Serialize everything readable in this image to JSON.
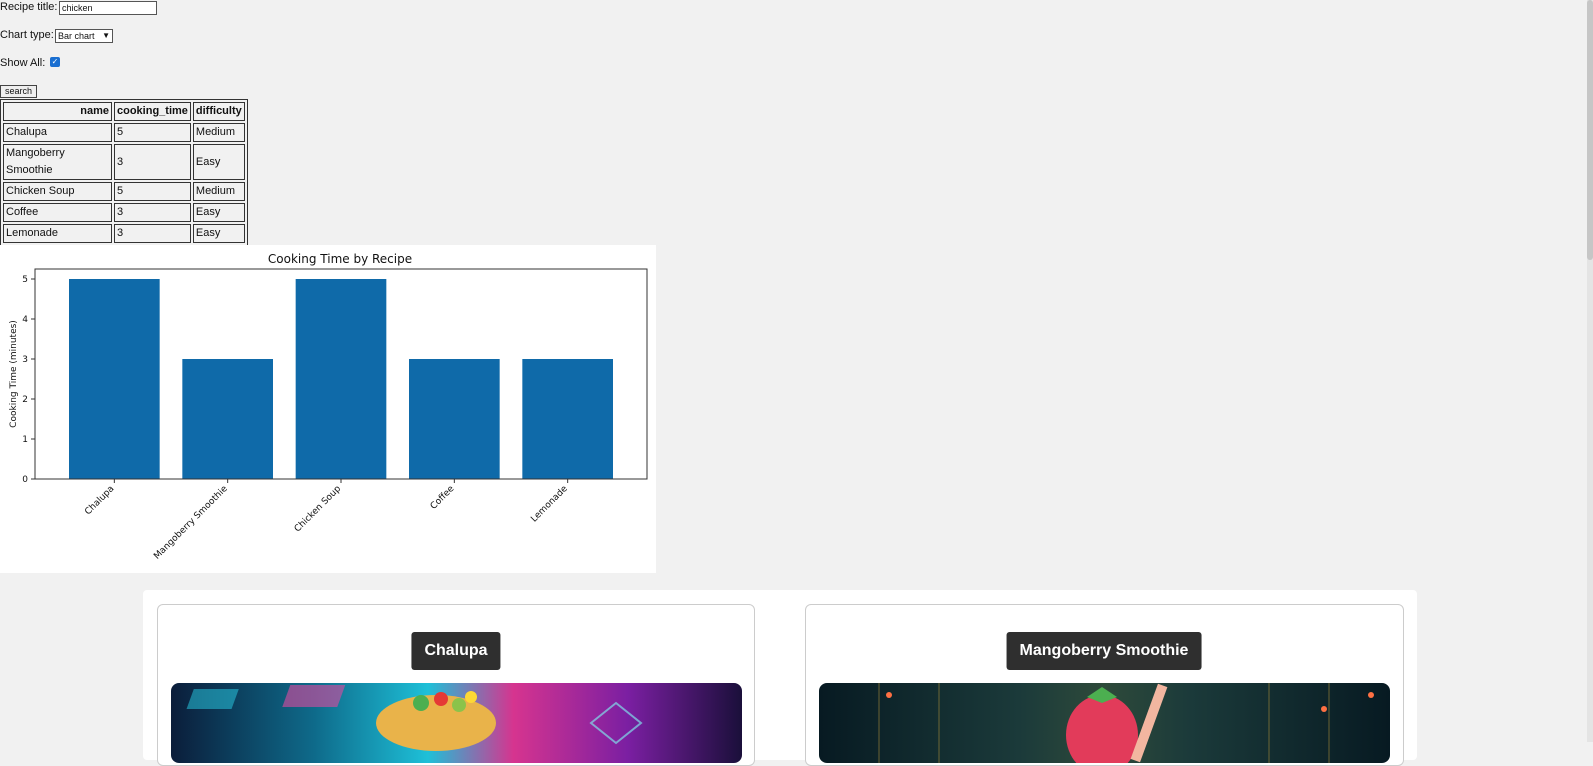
{
  "form": {
    "title_label": "Recipe title:",
    "title_value": "chicken",
    "chart_type_label": "Chart type:",
    "chart_type_value": "Bar chart",
    "show_all_label": "Show All:",
    "show_all_checked": true,
    "search_label": "search"
  },
  "table": {
    "headers": [
      "name",
      "cooking_time",
      "difficulty"
    ],
    "rows": [
      [
        "Chalupa",
        "5",
        "Medium"
      ],
      [
        "Mangoberry Smoothie",
        "3",
        "Easy"
      ],
      [
        "Chicken Soup",
        "5",
        "Medium"
      ],
      [
        "Coffee",
        "3",
        "Easy"
      ],
      [
        "Lemonade",
        "3",
        "Easy"
      ]
    ]
  },
  "chart_data": {
    "type": "bar",
    "title": "Cooking Time by Recipe",
    "xlabel": "",
    "ylabel": "Cooking Time (minutes)",
    "categories": [
      "Chalupa",
      "Mangoberry Smoothie",
      "Chicken Soup",
      "Coffee",
      "Lemonade"
    ],
    "values": [
      5,
      3,
      5,
      3,
      3
    ],
    "ylim": [
      0,
      5.25
    ],
    "yticks": [
      "0",
      "1",
      "2",
      "3",
      "4",
      "5"
    ],
    "bar_color": "#0f6aa9",
    "grid": false,
    "legend": "none"
  },
  "cards": [
    {
      "title": "Chalupa"
    },
    {
      "title": "Mangoberry Smoothie"
    }
  ],
  "colors": {
    "page_bg": "#f1f1f1",
    "card_title_bg": "#2f2f2f",
    "checkbox": "#1a6fd1"
  }
}
